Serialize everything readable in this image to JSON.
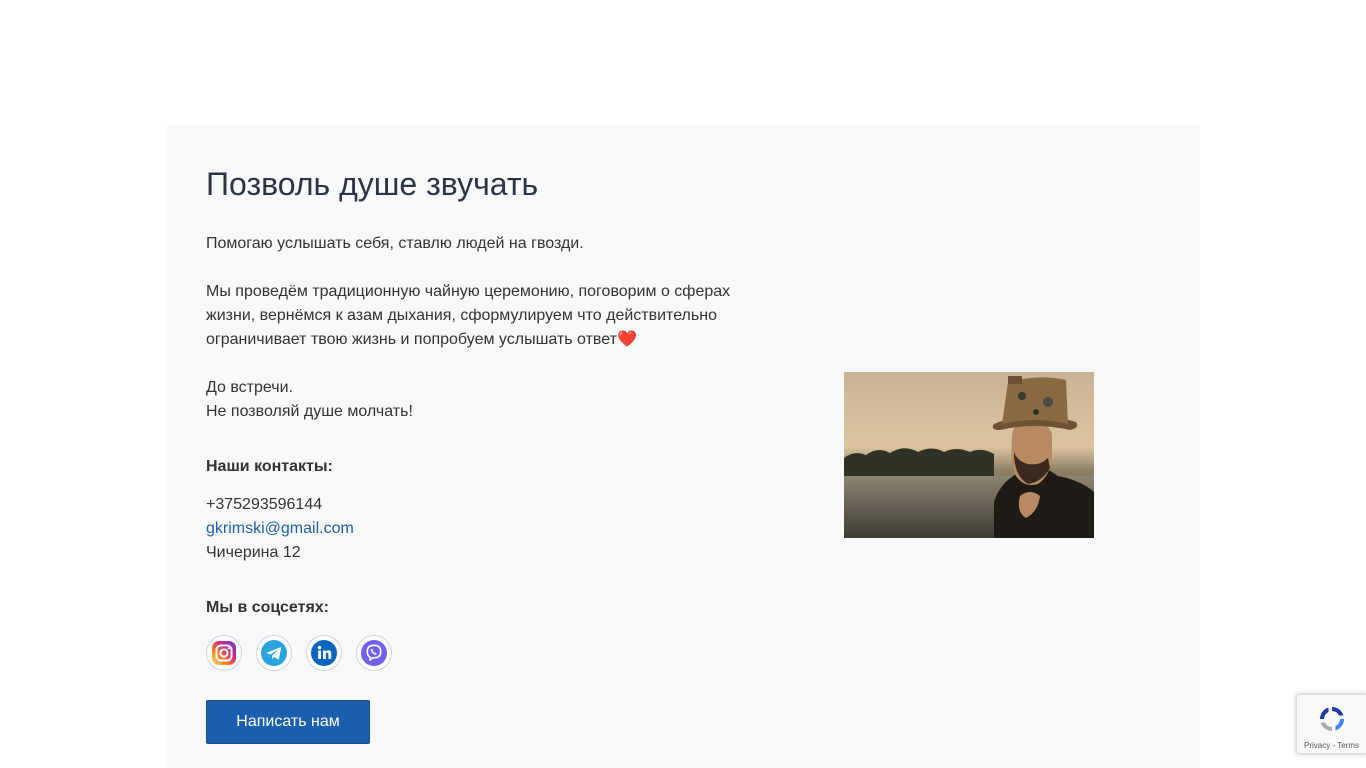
{
  "section": {
    "title": "Позволь душе звучать",
    "intro": "Помогаю услышать себя, ставлю людей на гвозди.",
    "body": "Мы проведём традиционную чайную церемонию, поговорим о сферах жизни, вернёмся к азам дыхания, сформулируем что действительно ограничивает твою жизнь и попробуем услышать ответ",
    "heart": "❤️",
    "farewell_1": "До встречи.",
    "farewell_2": "Не позволяй душе молчать!"
  },
  "contacts": {
    "heading": "Наши контакты:",
    "phone": "+375293596144",
    "email": "gkrimski@gmail.com",
    "address": "Чичерина 12"
  },
  "social": {
    "heading": "Мы в соцсетях:",
    "items": [
      {
        "name": "instagram",
        "icon": "instagram-icon"
      },
      {
        "name": "telegram",
        "icon": "telegram-icon"
      },
      {
        "name": "linkedin",
        "icon": "linkedin-icon"
      },
      {
        "name": "viber",
        "icon": "viber-icon"
      }
    ]
  },
  "cta": {
    "label": "Написать нам"
  },
  "photo": {
    "alt": ""
  },
  "recaptcha": {
    "terms": "Privacy - Terms"
  },
  "colors": {
    "accent": "#1b5fae",
    "link": "#1e5fa8",
    "card_bg": "#f7f9fb",
    "title": "#2c3447"
  }
}
